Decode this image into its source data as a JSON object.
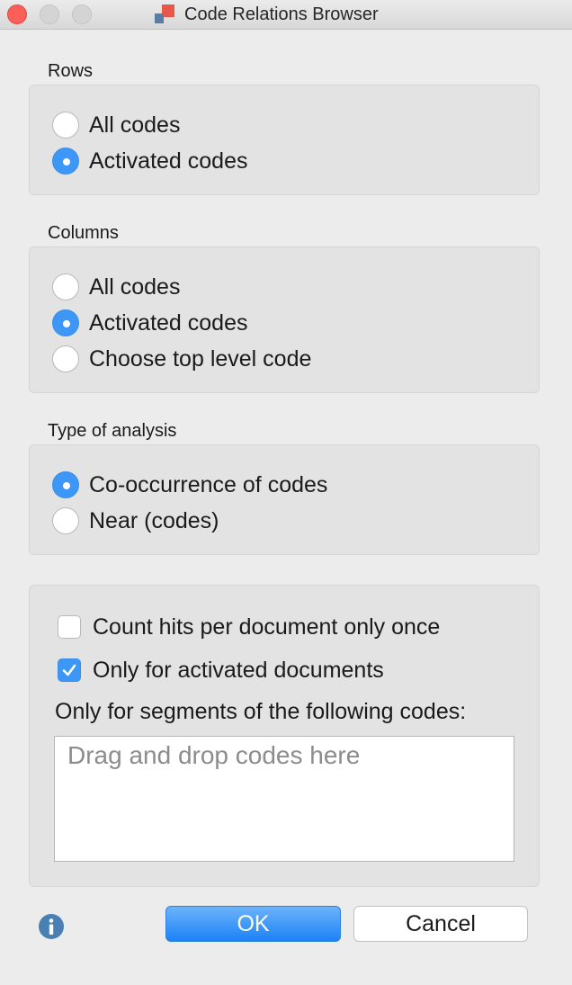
{
  "window": {
    "title": "Code Relations Browser"
  },
  "rows": {
    "label": "Rows",
    "options": [
      {
        "label": "All codes",
        "selected": false
      },
      {
        "label": "Activated codes",
        "selected": true
      }
    ]
  },
  "columns": {
    "label": "Columns",
    "options": [
      {
        "label": "All codes",
        "selected": false
      },
      {
        "label": "Activated codes",
        "selected": true
      },
      {
        "label": "Choose top level code",
        "selected": false
      }
    ]
  },
  "analysis": {
    "label": "Type of analysis",
    "options": [
      {
        "label": "Co-occurrence of codes",
        "selected": true
      },
      {
        "label": "Near (codes)",
        "selected": false
      }
    ]
  },
  "options": {
    "count_hits_label": "Count hits per document only once",
    "count_hits_checked": false,
    "activated_docs_label": "Only for activated documents",
    "activated_docs_checked": true,
    "segments_label": "Only for segments of the following codes:",
    "drop_placeholder": "Drag and drop codes here"
  },
  "buttons": {
    "ok": "OK",
    "cancel": "Cancel"
  },
  "icons": {
    "info": "info-icon",
    "app": "code-relations-app-icon",
    "check": "checkmark-icon"
  },
  "colors": {
    "accent": "#3d97f7",
    "close_button": "#fc5f57",
    "app_icon_red": "#e8584a",
    "app_icon_blue": "#5a7da5",
    "info_icon": "#4a7fb3"
  }
}
